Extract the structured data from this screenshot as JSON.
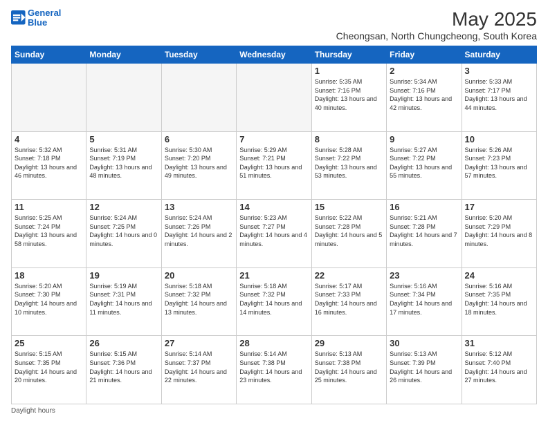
{
  "header": {
    "logo_line1": "General",
    "logo_line2": "Blue",
    "main_title": "May 2025",
    "subtitle": "Cheongsan, North Chungcheong, South Korea"
  },
  "days_of_week": [
    "Sunday",
    "Monday",
    "Tuesday",
    "Wednesday",
    "Thursday",
    "Friday",
    "Saturday"
  ],
  "weeks": [
    [
      {
        "day": "",
        "empty": true
      },
      {
        "day": "",
        "empty": true
      },
      {
        "day": "",
        "empty": true
      },
      {
        "day": "",
        "empty": true
      },
      {
        "day": "1",
        "sunrise": "5:35 AM",
        "sunset": "7:16 PM",
        "daylight": "13 hours and 40 minutes."
      },
      {
        "day": "2",
        "sunrise": "5:34 AM",
        "sunset": "7:16 PM",
        "daylight": "13 hours and 42 minutes."
      },
      {
        "day": "3",
        "sunrise": "5:33 AM",
        "sunset": "7:17 PM",
        "daylight": "13 hours and 44 minutes."
      }
    ],
    [
      {
        "day": "4",
        "sunrise": "5:32 AM",
        "sunset": "7:18 PM",
        "daylight": "13 hours and 46 minutes."
      },
      {
        "day": "5",
        "sunrise": "5:31 AM",
        "sunset": "7:19 PM",
        "daylight": "13 hours and 48 minutes."
      },
      {
        "day": "6",
        "sunrise": "5:30 AM",
        "sunset": "7:20 PM",
        "daylight": "13 hours and 49 minutes."
      },
      {
        "day": "7",
        "sunrise": "5:29 AM",
        "sunset": "7:21 PM",
        "daylight": "13 hours and 51 minutes."
      },
      {
        "day": "8",
        "sunrise": "5:28 AM",
        "sunset": "7:22 PM",
        "daylight": "13 hours and 53 minutes."
      },
      {
        "day": "9",
        "sunrise": "5:27 AM",
        "sunset": "7:22 PM",
        "daylight": "13 hours and 55 minutes."
      },
      {
        "day": "10",
        "sunrise": "5:26 AM",
        "sunset": "7:23 PM",
        "daylight": "13 hours and 57 minutes."
      }
    ],
    [
      {
        "day": "11",
        "sunrise": "5:25 AM",
        "sunset": "7:24 PM",
        "daylight": "13 hours and 58 minutes."
      },
      {
        "day": "12",
        "sunrise": "5:24 AM",
        "sunset": "7:25 PM",
        "daylight": "14 hours and 0 minutes."
      },
      {
        "day": "13",
        "sunrise": "5:24 AM",
        "sunset": "7:26 PM",
        "daylight": "14 hours and 2 minutes."
      },
      {
        "day": "14",
        "sunrise": "5:23 AM",
        "sunset": "7:27 PM",
        "daylight": "14 hours and 4 minutes."
      },
      {
        "day": "15",
        "sunrise": "5:22 AM",
        "sunset": "7:28 PM",
        "daylight": "14 hours and 5 minutes."
      },
      {
        "day": "16",
        "sunrise": "5:21 AM",
        "sunset": "7:28 PM",
        "daylight": "14 hours and 7 minutes."
      },
      {
        "day": "17",
        "sunrise": "5:20 AM",
        "sunset": "7:29 PM",
        "daylight": "14 hours and 8 minutes."
      }
    ],
    [
      {
        "day": "18",
        "sunrise": "5:20 AM",
        "sunset": "7:30 PM",
        "daylight": "14 hours and 10 minutes."
      },
      {
        "day": "19",
        "sunrise": "5:19 AM",
        "sunset": "7:31 PM",
        "daylight": "14 hours and 11 minutes."
      },
      {
        "day": "20",
        "sunrise": "5:18 AM",
        "sunset": "7:32 PM",
        "daylight": "14 hours and 13 minutes."
      },
      {
        "day": "21",
        "sunrise": "5:18 AM",
        "sunset": "7:32 PM",
        "daylight": "14 hours and 14 minutes."
      },
      {
        "day": "22",
        "sunrise": "5:17 AM",
        "sunset": "7:33 PM",
        "daylight": "14 hours and 16 minutes."
      },
      {
        "day": "23",
        "sunrise": "5:16 AM",
        "sunset": "7:34 PM",
        "daylight": "14 hours and 17 minutes."
      },
      {
        "day": "24",
        "sunrise": "5:16 AM",
        "sunset": "7:35 PM",
        "daylight": "14 hours and 18 minutes."
      }
    ],
    [
      {
        "day": "25",
        "sunrise": "5:15 AM",
        "sunset": "7:35 PM",
        "daylight": "14 hours and 20 minutes."
      },
      {
        "day": "26",
        "sunrise": "5:15 AM",
        "sunset": "7:36 PM",
        "daylight": "14 hours and 21 minutes."
      },
      {
        "day": "27",
        "sunrise": "5:14 AM",
        "sunset": "7:37 PM",
        "daylight": "14 hours and 22 minutes."
      },
      {
        "day": "28",
        "sunrise": "5:14 AM",
        "sunset": "7:38 PM",
        "daylight": "14 hours and 23 minutes."
      },
      {
        "day": "29",
        "sunrise": "5:13 AM",
        "sunset": "7:38 PM",
        "daylight": "14 hours and 25 minutes."
      },
      {
        "day": "30",
        "sunrise": "5:13 AM",
        "sunset": "7:39 PM",
        "daylight": "14 hours and 26 minutes."
      },
      {
        "day": "31",
        "sunrise": "5:12 AM",
        "sunset": "7:40 PM",
        "daylight": "14 hours and 27 minutes."
      }
    ]
  ],
  "footer": {
    "daylight_label": "Daylight hours"
  },
  "labels": {
    "sunrise": "Sunrise:",
    "sunset": "Sunset:",
    "daylight": "Daylight:"
  }
}
